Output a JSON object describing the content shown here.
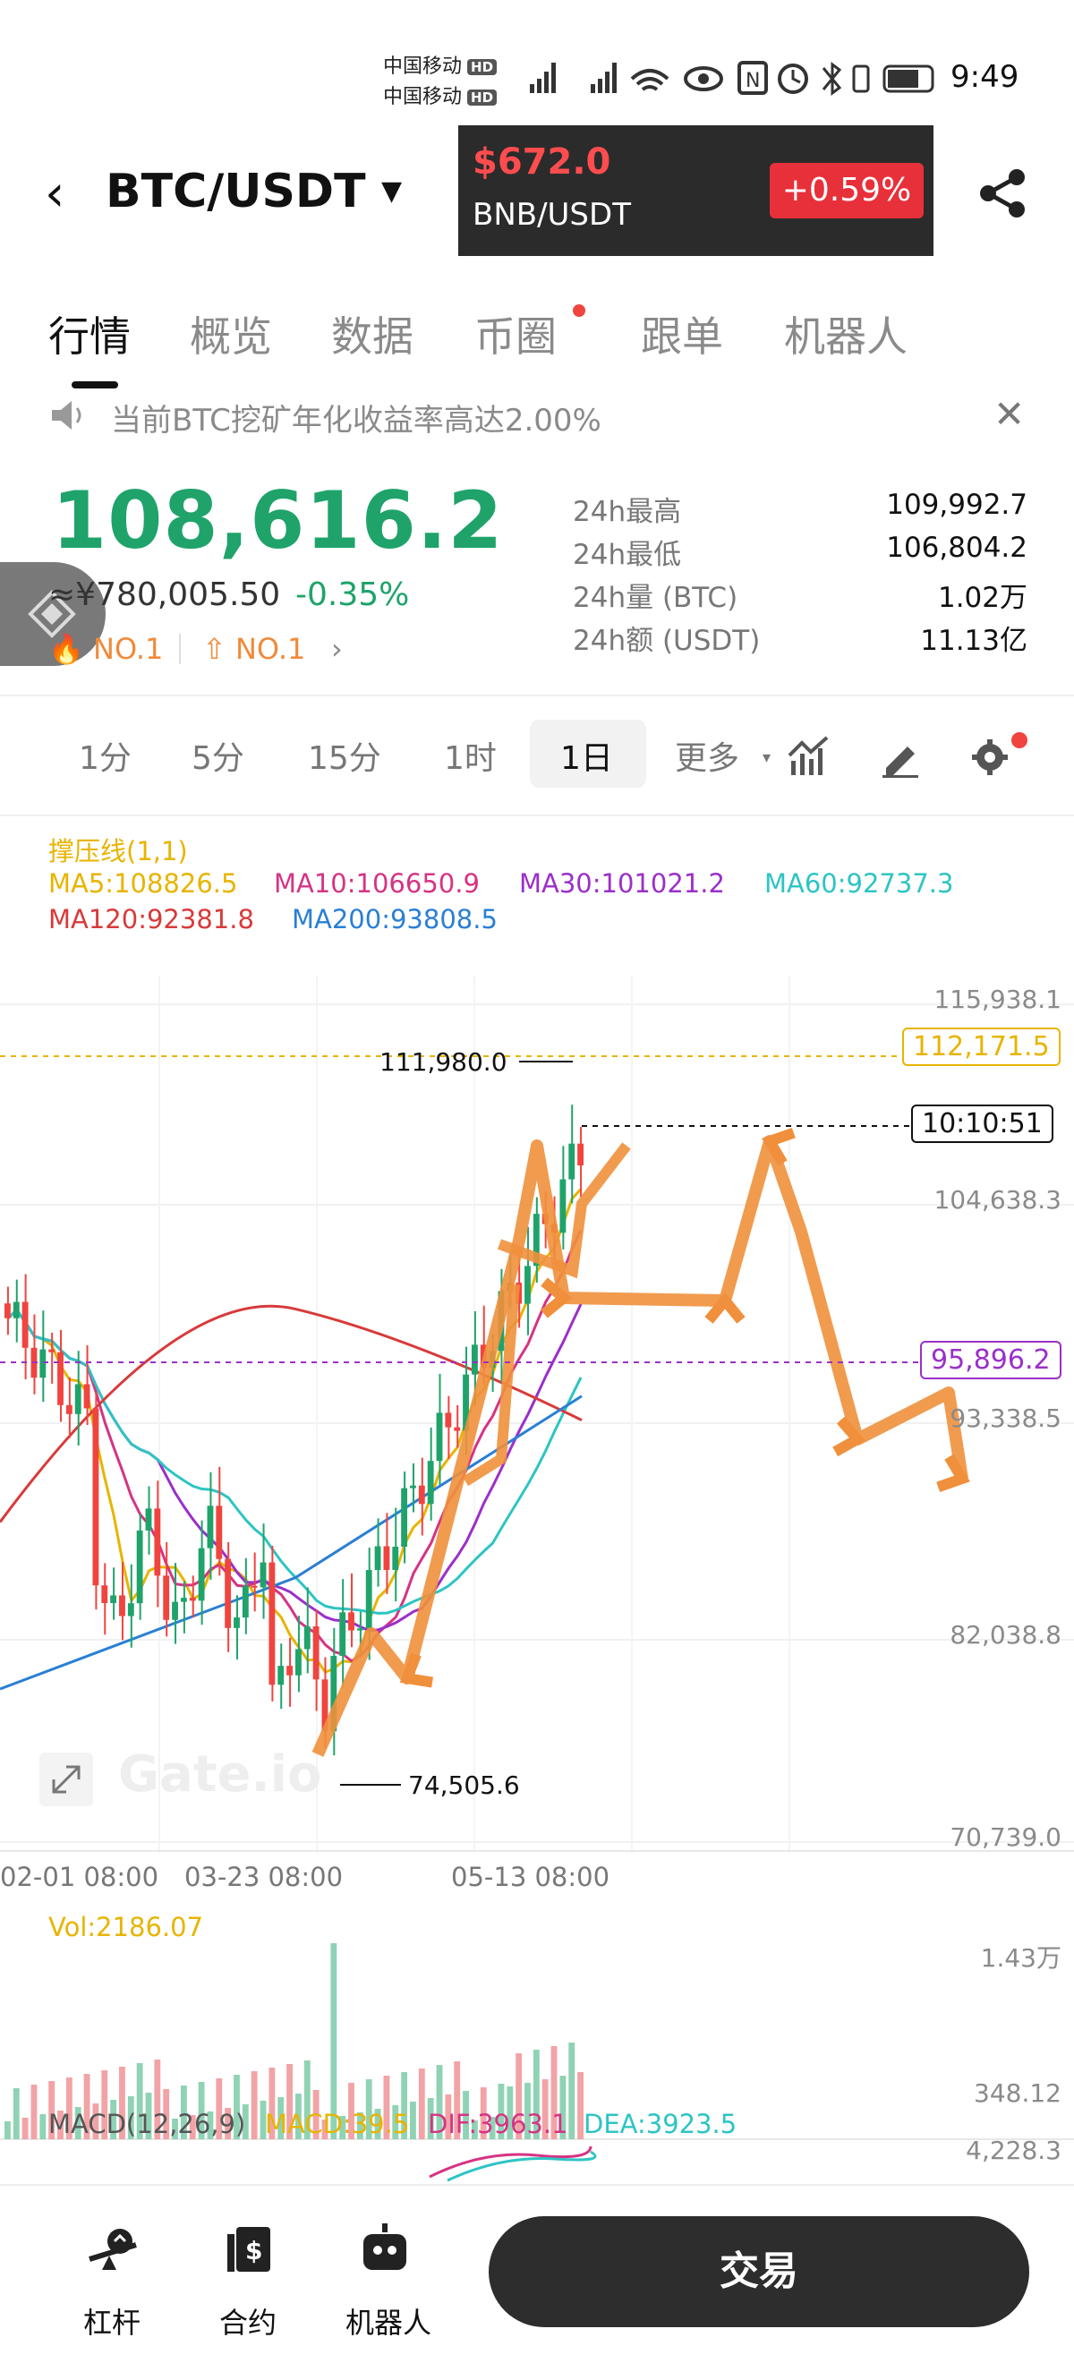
{
  "status_bar": {
    "carrier_1": "中国移动",
    "carrier_2": "中国移动",
    "hd": "HD",
    "time": "9:49"
  },
  "header": {
    "pair": "BTC/USDT",
    "popup": {
      "price": "$672.0",
      "pair": "BNB/USDT",
      "change": "+0.59%"
    }
  },
  "tabs": [
    {
      "label": "行情"
    },
    {
      "label": "概览"
    },
    {
      "label": "数据"
    },
    {
      "label": "币圈"
    },
    {
      "label": "跟单"
    },
    {
      "label": "机器人"
    }
  ],
  "notice": {
    "text": "当前BTC挖矿年化收益率高达2.00%"
  },
  "ticker": {
    "last_price": "108,616.2",
    "cny_price": "≈¥780,005.50",
    "change_pct": "-0.35%",
    "rank_1": "NO.1",
    "rank_2": "NO.1",
    "stats": [
      {
        "label": "24h最高",
        "value": "109,992.7"
      },
      {
        "label": "24h最低",
        "value": "106,804.2"
      },
      {
        "label": "24h量 (BTC)",
        "value": "1.02万"
      },
      {
        "label": "24h额 (USDT)",
        "value": "11.13亿"
      }
    ]
  },
  "intervals": [
    "1分",
    "5分",
    "15分",
    "1时",
    "1日",
    "更多"
  ],
  "active_interval": "1日",
  "indicators": {
    "support_line": "撑压线(1,1)",
    "ma5": "MA5:108826.5",
    "ma10": "MA10:106650.9",
    "ma30": "MA30:101021.2",
    "ma60": "MA60:92737.3",
    "ma120": "MA120:92381.8",
    "ma200": "MA200:93808.5"
  },
  "colors": {
    "up": "#1fa36b",
    "down": "#f0443f",
    "ma5": "#e8b400",
    "ma10": "#d63384",
    "ma30": "#9b2fc9",
    "ma60": "#2ec4c4",
    "ma120": "#d83a3a",
    "ma200": "#2a7fd4",
    "annotation": "#f0903c"
  },
  "chart_data": {
    "type": "candlestick",
    "y_axis_ticks": [
      "115,938.1",
      "104,638.3",
      "93,338.5",
      "82,038.8",
      "70,739.0"
    ],
    "x_axis_ticks": [
      "02-01 08:00",
      "03-23 08:00",
      "05-13 08:00"
    ],
    "ylim": [
      70739.0,
      115938.1
    ],
    "high_label": "111,980.0",
    "low_label": "74,505.6",
    "price_tag_upper": "112,171.5",
    "countdown_tag": "10:10:51",
    "price_tag_lower": "95,896.2",
    "watermark": "Gate.io"
  },
  "volume": {
    "label": "Vol:2186.07",
    "max": "1.43万",
    "min": "348.12"
  },
  "macd": {
    "label": "MACD(12,26,9)",
    "macd": "MACD:39.5",
    "dif": "DIF:3963.1",
    "dea": "DEA:3923.5",
    "axis": "4,228.3"
  },
  "bottom_nav": {
    "leverage": "杠杆",
    "futures": "合约",
    "bots": "机器人",
    "trade": "交易"
  }
}
